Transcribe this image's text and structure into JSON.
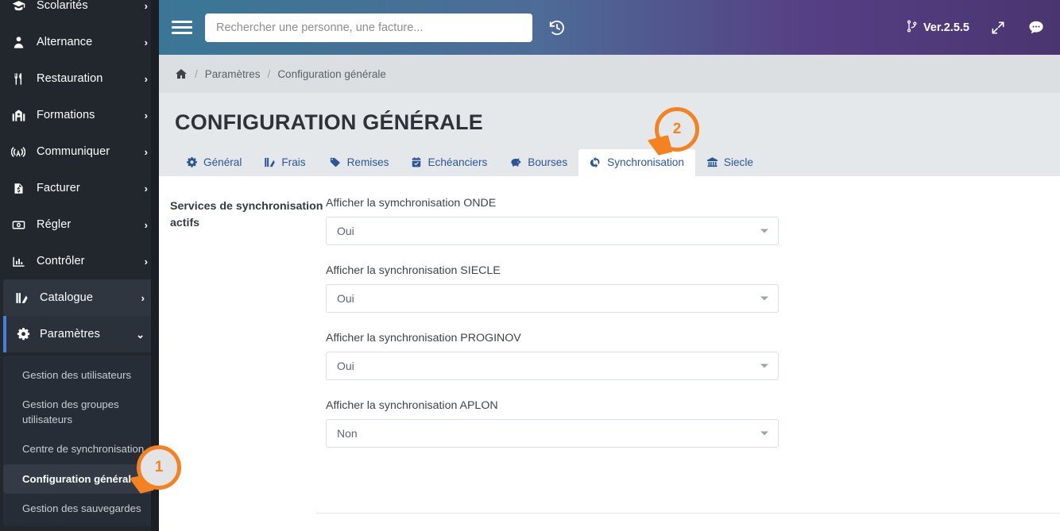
{
  "sidebar": {
    "items": [
      {
        "label": "Scolarités",
        "icon": "graduation-cap-icon",
        "chevron": "›"
      },
      {
        "label": "Alternance",
        "icon": "user-tie-icon",
        "chevron": "›"
      },
      {
        "label": "Restauration",
        "icon": "utensils-icon",
        "chevron": "›"
      },
      {
        "label": "Formations",
        "icon": "school-building-icon",
        "chevron": "›"
      },
      {
        "label": "Communiquer",
        "icon": "broadcast-tower-icon",
        "chevron": "›"
      },
      {
        "label": "Facturer",
        "icon": "invoice-icon",
        "chevron": "›"
      },
      {
        "label": "Régler",
        "icon": "money-bill-icon",
        "chevron": "›"
      },
      {
        "label": "Contrôler",
        "icon": "chart-bar-icon",
        "chevron": "›"
      },
      {
        "label": "Catalogue",
        "icon": "book-swatch-icon",
        "chevron": "›"
      },
      {
        "label": "Paramètres",
        "icon": "gears-icon",
        "chevron": "⌄"
      }
    ],
    "submenu": [
      {
        "label": "Gestion des utilisateurs",
        "selected": false
      },
      {
        "label": "Gestion des groupes utilisateurs",
        "selected": false
      },
      {
        "label": "Centre de synchronisation",
        "selected": false
      },
      {
        "label": "Configuration générale",
        "selected": true
      },
      {
        "label": "Gestion des sauvegardes",
        "selected": false
      }
    ]
  },
  "topbar": {
    "menu_icon": "hamburger-icon",
    "search_placeholder": "Rechercher une personne, une facture...",
    "search_value": "",
    "history_icon": "history-clock-icon",
    "version_icon": "code-branch-icon",
    "version_label": "Ver.2.5.5",
    "expand_icon": "expand-arrows-icon",
    "chat_icon": "chat-bubble-icon"
  },
  "breadcrumb": {
    "home_icon": "home-icon",
    "separator": "/",
    "items": [
      {
        "label": "Paramètres"
      },
      {
        "label": "Configuration générale"
      }
    ]
  },
  "page": {
    "title": "CONFIGURATION GÉNÉRALE"
  },
  "tabs": [
    {
      "label": "Général",
      "icon": "gears-icon",
      "active": false
    },
    {
      "label": "Frais",
      "icon": "chart-swatch-icon",
      "active": false
    },
    {
      "label": "Remises",
      "icon": "tag-icon",
      "active": false
    },
    {
      "label": "Echéanciers",
      "icon": "calendar-check-icon",
      "active": false
    },
    {
      "label": "Bourses",
      "icon": "piggy-bank-icon",
      "active": false
    },
    {
      "label": "Synchronisation",
      "icon": "sync-icon",
      "active": true
    },
    {
      "label": "Siecle",
      "icon": "bank-columns-icon",
      "active": false
    }
  ],
  "form": {
    "legend": "Services de synchronisation actifs",
    "fields": [
      {
        "label": "Afficher la symchronisation ONDE",
        "value": "Oui"
      },
      {
        "label": "Afficher la synchronisation SIECLE",
        "value": "Oui"
      },
      {
        "label": "Afficher la synchronisation PROGINOV",
        "value": "Oui"
      },
      {
        "label": "Afficher la synchronisation APLON",
        "value": "Non"
      }
    ]
  },
  "callouts": [
    {
      "number": "1"
    },
    {
      "number": "2"
    }
  ],
  "colors": {
    "accent_orange": "#f58220",
    "sidebar_bg": "#22272e",
    "active_marker": "#4a7fd4",
    "tab_text": "#2a5597",
    "header_gradient_start": "#3a7796",
    "header_gradient_end": "#4a3570"
  }
}
